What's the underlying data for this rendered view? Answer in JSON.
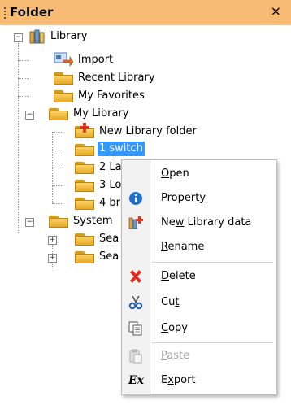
{
  "panel": {
    "title": "Folder",
    "close_glyph": "×"
  },
  "tree": {
    "library": "Library",
    "import": "Import",
    "recent": "Recent Library",
    "favorites": "My Favorites",
    "my_library": "My Library",
    "new_folder": "New Library folder",
    "item1": "1 switch",
    "item2": "2 La",
    "item3": "3 Lo",
    "item4": "4 br",
    "system": "System",
    "sea1": "Sea",
    "sea2": "Sea",
    "expand_minus": "−",
    "expand_plus": "+"
  },
  "menu": {
    "open": {
      "before": "",
      "key": "O",
      "after": "pen"
    },
    "property": {
      "before": "Propert",
      "key": "y",
      "after": ""
    },
    "new_data": {
      "before": "Ne",
      "key": "w",
      "after": " Library data"
    },
    "rename": {
      "before": "",
      "key": "R",
      "after": "ename"
    },
    "delete": {
      "before": "",
      "key": "D",
      "after": "elete"
    },
    "cut": {
      "before": "Cu",
      "key": "t",
      "after": ""
    },
    "copy": {
      "before": "",
      "key": "C",
      "after": "opy"
    },
    "paste": {
      "before": "",
      "key": "P",
      "after": "aste"
    },
    "export": {
      "before": "E",
      "key": "x",
      "after": "port"
    },
    "export_icon_text": "Ex"
  },
  "icons": {
    "property": "info-icon",
    "delete": "delete-icon",
    "cut": "scissors-icon",
    "copy": "copy-icon",
    "paste": "paste-icon",
    "export": "export-icon"
  }
}
